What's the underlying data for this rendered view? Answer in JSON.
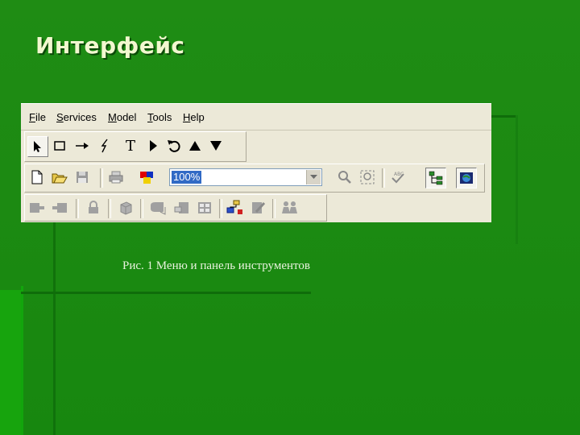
{
  "slide": {
    "title": "Интерфейс",
    "caption": "Рис. 1 Меню и панель инструментов"
  },
  "menu": {
    "items": [
      {
        "mn": "F",
        "rest": "ile"
      },
      {
        "mn": "S",
        "rest": "ervices"
      },
      {
        "mn": "M",
        "rest": "odel"
      },
      {
        "mn": "T",
        "rest": "ools"
      },
      {
        "mn": "H",
        "rest": "elp"
      }
    ]
  },
  "toolbar_text_tool": "T",
  "zoom": {
    "value": "100%"
  },
  "colors": {
    "slide_bg": "#1f8c14",
    "window_bg": "#ece9d8",
    "selection": "#316ac5"
  }
}
